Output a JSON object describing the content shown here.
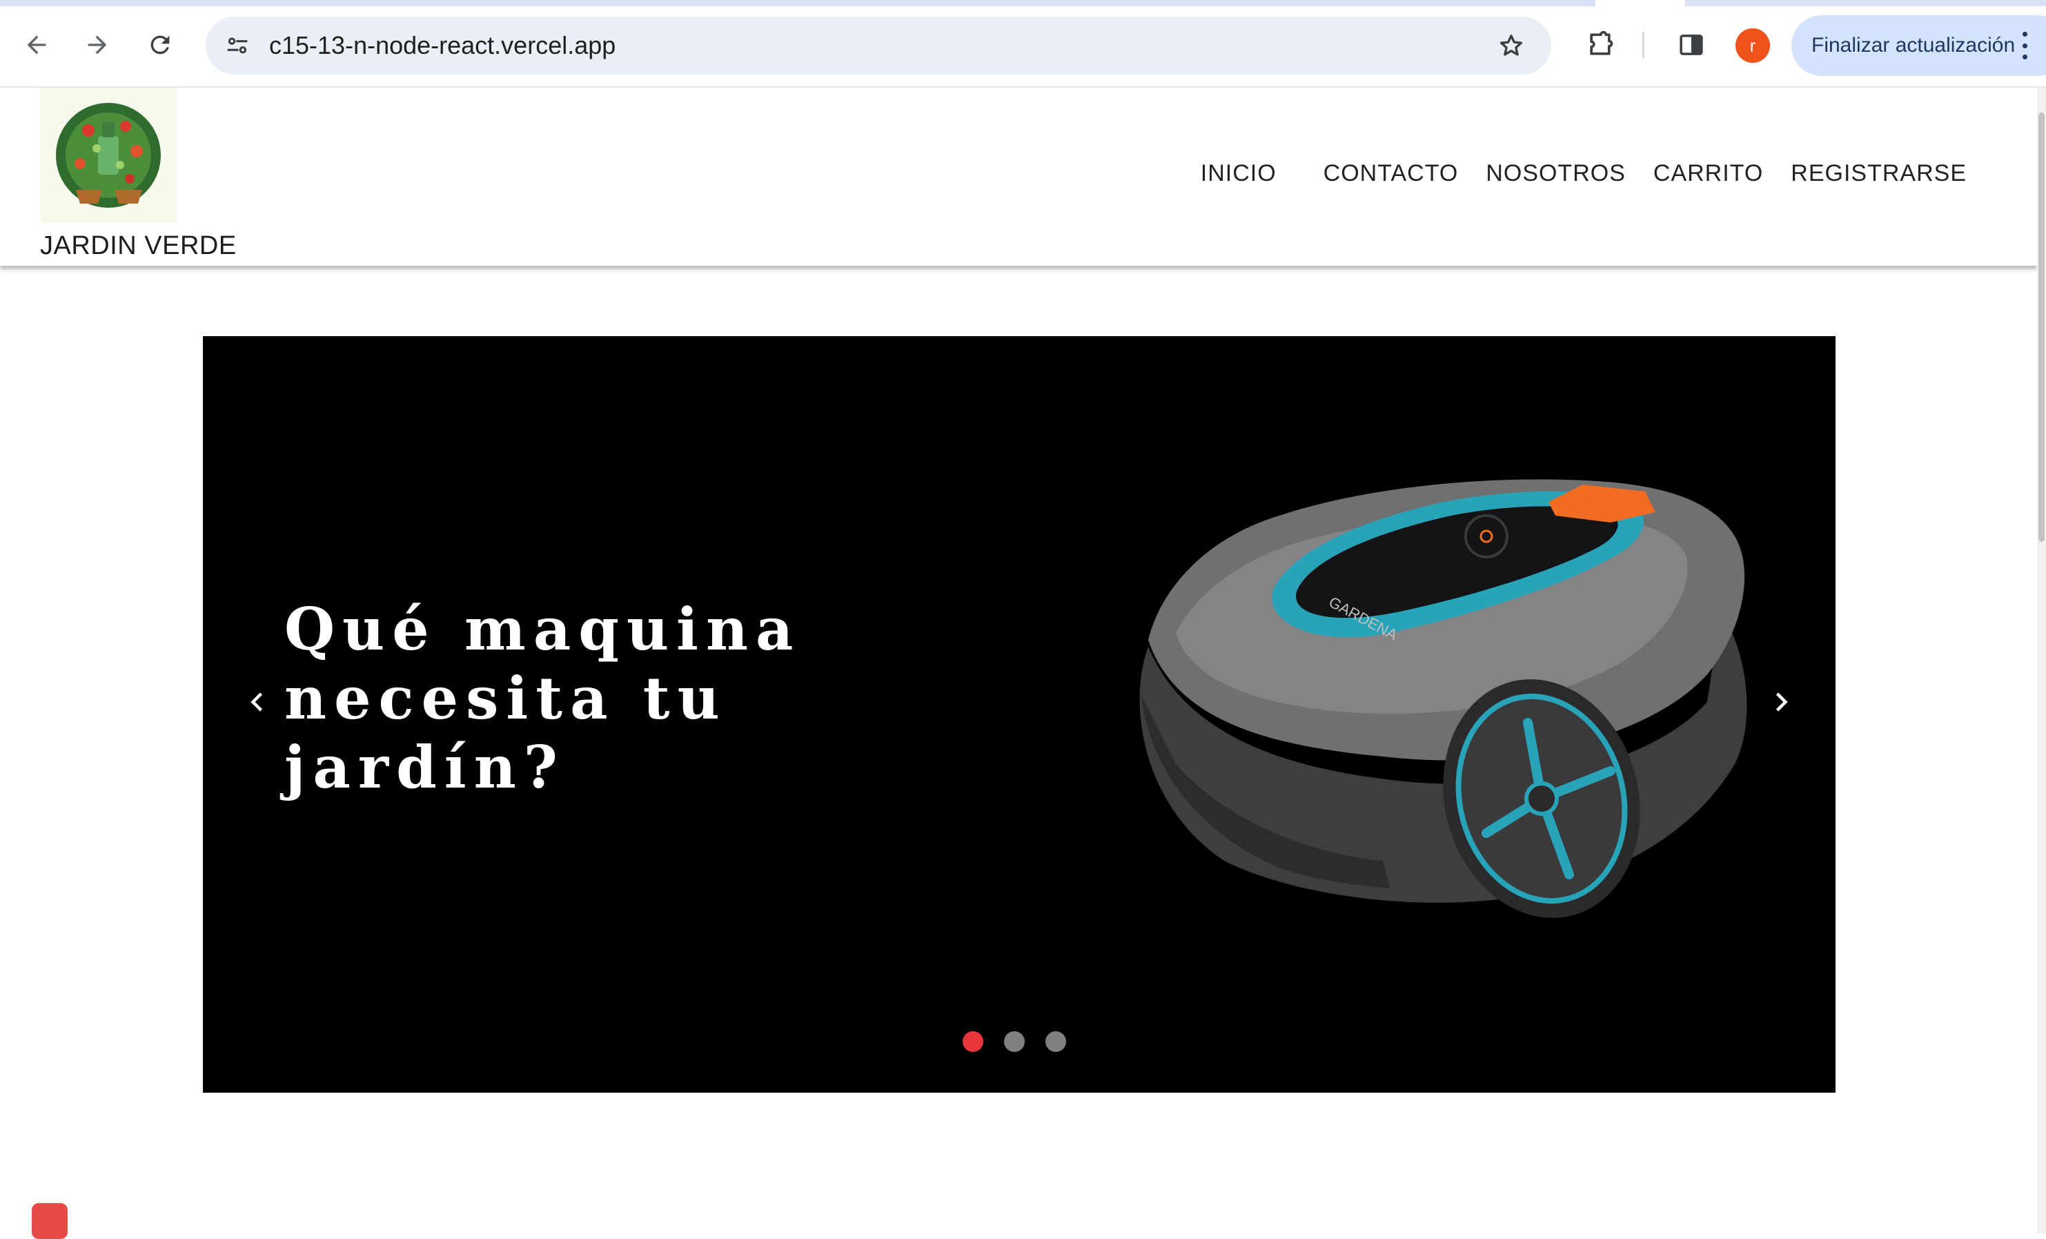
{
  "browser": {
    "url": "c15-13-n-node-react.vercel.app",
    "profile_initial": "r",
    "update_label": "Finalizar actualización",
    "icons": [
      "back-arrow-icon",
      "forward-arrow-icon",
      "reload-icon",
      "site-settings-icon",
      "bookmark-star-icon",
      "extensions-icon",
      "side-panel-icon",
      "more-menu-icon"
    ]
  },
  "site": {
    "brand": "JARDIN VERDE",
    "nav": [
      "INICIO",
      "CONTACTO",
      "NOSOTROS",
      "CARRITO",
      "REGISTRARSE"
    ]
  },
  "carousel": {
    "caption": "Qué maquina necesita tu jardín?",
    "robot_brand": "GARDENA",
    "slide_count": 3,
    "active_index": 0,
    "colors": {
      "active_dot": "#e8363b",
      "inactive_dot": "#808080",
      "accent": "#29a3b8",
      "orange": "#f26d21"
    }
  }
}
